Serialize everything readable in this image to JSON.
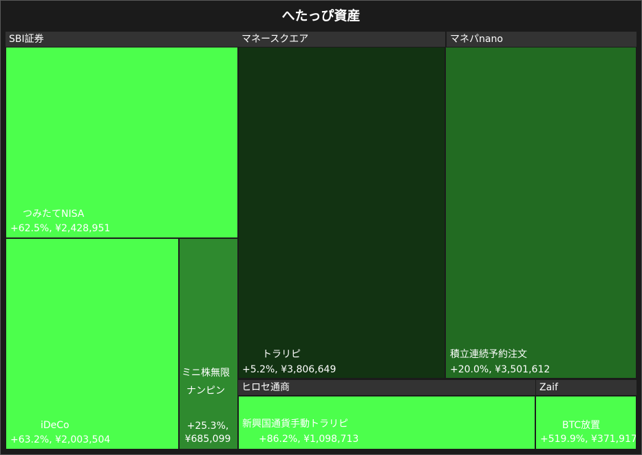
{
  "title": "へたっぴ資産",
  "colors": {
    "bright": "#4cff4c",
    "medium": "#2f8a2f",
    "dark_green": "#226b22",
    "darkest": "#123312"
  },
  "groups": [
    {
      "label": "SBI証券"
    },
    {
      "label": "マネースクエア"
    },
    {
      "label": "マネパnano"
    },
    {
      "label": "ヒロセ通商"
    },
    {
      "label": "Zaif"
    }
  ],
  "tiles": [
    {
      "label": "つみたてNISA",
      "value": "+62.5%, ¥2,428,951"
    },
    {
      "label": "iDeCo",
      "value": "+63.2%, ¥2,003,504"
    },
    {
      "label": "ミニ株無限ナンピン",
      "value": "+25.3%, ¥685,099"
    },
    {
      "label": "トラリピ",
      "value": "+5.2%, ¥3,806,649"
    },
    {
      "label": "積立連続予約注文",
      "value": "+20.0%, ¥3,501,612"
    },
    {
      "label": "新興国通貨手動トラリピ",
      "value": "+86.2%, ¥1,098,713"
    },
    {
      "label": "BTC放置",
      "value": "+519.9%, ¥371,917"
    }
  ],
  "chart_data": {
    "type": "treemap",
    "title": "へたっぴ資産",
    "groups": [
      {
        "name": "SBI証券",
        "items": [
          {
            "name": "つみたてNISA",
            "return_pct": 62.5,
            "value": 2428951
          },
          {
            "name": "iDeCo",
            "return_pct": 63.2,
            "value": 2003504
          },
          {
            "name": "ミニ株無限ナンピン",
            "return_pct": 25.3,
            "value": 685099
          }
        ]
      },
      {
        "name": "マネースクエア",
        "items": [
          {
            "name": "トラリピ",
            "return_pct": 5.2,
            "value": 3806649
          }
        ]
      },
      {
        "name": "マネパnano",
        "items": [
          {
            "name": "積立連続予約注文",
            "return_pct": 20.0,
            "value": 3501612
          }
        ]
      },
      {
        "name": "ヒロセ通商",
        "items": [
          {
            "name": "新興国通貨手動トラリピ",
            "return_pct": 86.2,
            "value": 1098713
          }
        ]
      },
      {
        "name": "Zaif",
        "items": [
          {
            "name": "BTC放置",
            "return_pct": 519.9,
            "value": 371917
          }
        ]
      }
    ]
  }
}
